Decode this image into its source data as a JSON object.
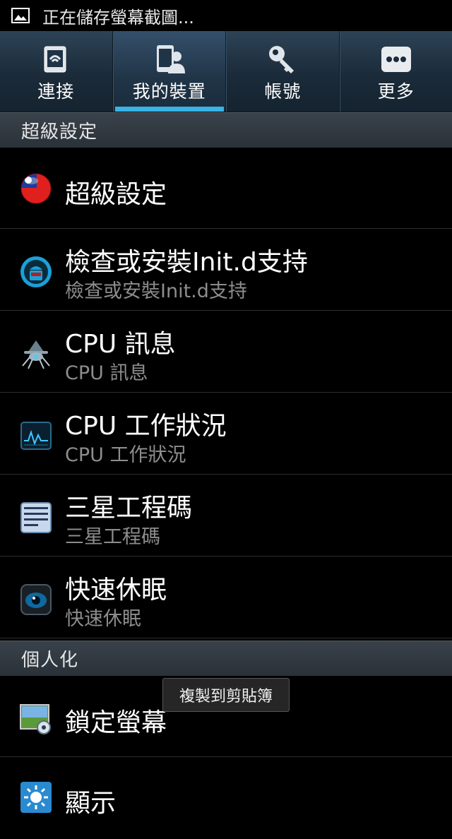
{
  "status_bar": {
    "icon": "image-icon",
    "text": "正在儲存螢幕截圖..."
  },
  "tabs": [
    {
      "label": "連接",
      "icon": "connections-icon",
      "active": false
    },
    {
      "label": "我的裝置",
      "icon": "my-device-icon",
      "active": true
    },
    {
      "label": "帳號",
      "icon": "accounts-key-icon",
      "active": false
    },
    {
      "label": "更多",
      "icon": "more-dots-icon",
      "active": false
    }
  ],
  "sections": [
    {
      "title": "超級設定"
    },
    {
      "title": "個人化"
    }
  ],
  "items": [
    {
      "title": "超級設定",
      "subtitle": "",
      "icon": "taiwan-flag-ball-icon"
    },
    {
      "title": "檢查或安裝Init.d支持",
      "subtitle": "檢查或安裝Init.d支持",
      "icon": "android-robot-icon"
    },
    {
      "title": "CPU 訊息",
      "subtitle": "CPU 訊息",
      "icon": "spider-robot-icon"
    },
    {
      "title": "CPU 工作狀況",
      "subtitle": "CPU 工作狀況",
      "icon": "cpu-monitor-icon"
    },
    {
      "title": "三星工程碼",
      "subtitle": "三星工程碼",
      "icon": "binary-code-icon"
    },
    {
      "title": "快速休眠",
      "subtitle": "快速休眠",
      "icon": "eye-sleep-icon"
    },
    {
      "title": "鎖定螢幕",
      "subtitle": "",
      "icon": "lock-screen-icon"
    },
    {
      "title": "顯示",
      "subtitle": "",
      "icon": "display-brightness-icon"
    }
  ],
  "toast": {
    "text": "複製到剪貼簿"
  },
  "colors": {
    "accent": "#38b4e6",
    "tab_bg": "#1b2b39",
    "section_bg": "#2f373e",
    "subtitle": "#8d8d8d"
  }
}
